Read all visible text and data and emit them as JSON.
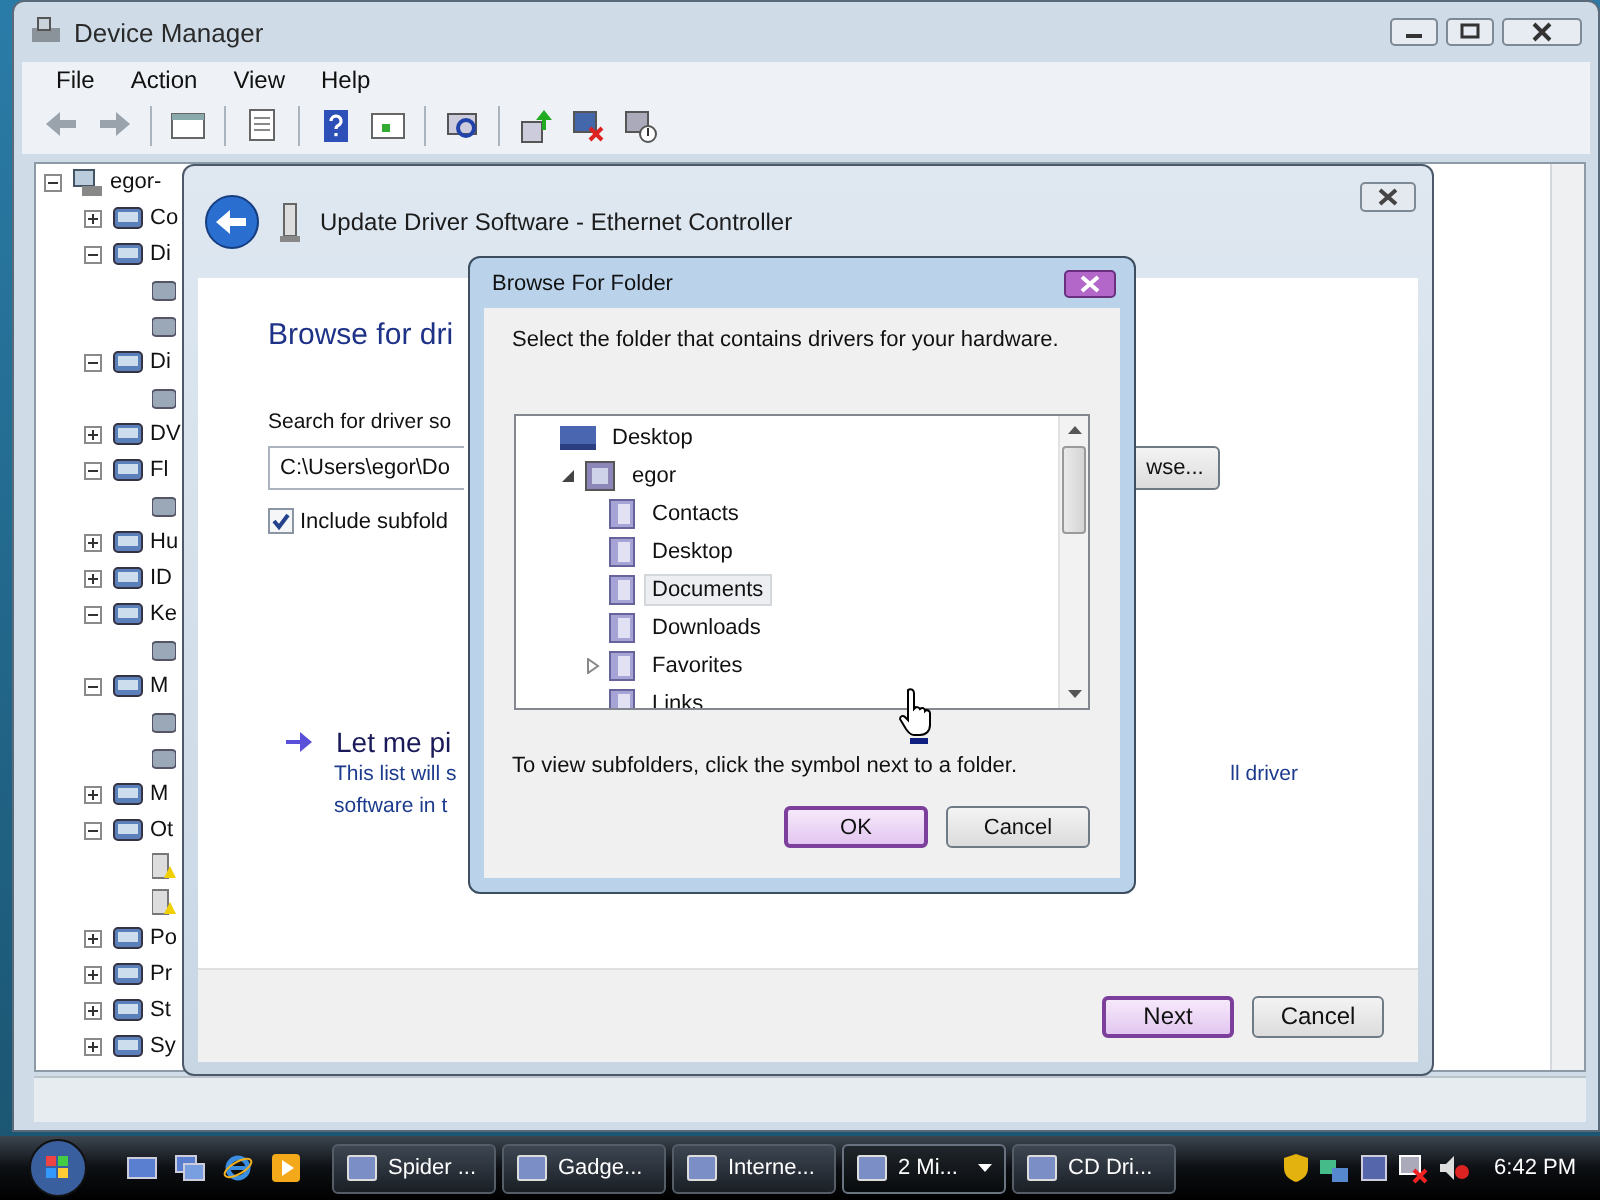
{
  "device_manager": {
    "title": "Device Manager",
    "menu": [
      "File",
      "Action",
      "View",
      "Help"
    ],
    "tree": [
      {
        "kind": "computer",
        "label": "egor-",
        "expanded": true,
        "children": [
          {
            "kind": "category",
            "label": "Co",
            "expanded": false
          },
          {
            "kind": "category",
            "label": "Di",
            "expanded": true,
            "children": [
              {
                "kind": "device"
              },
              {
                "kind": "device"
              }
            ]
          },
          {
            "kind": "category",
            "label": "Di",
            "expanded": true,
            "children": [
              {
                "kind": "device"
              }
            ]
          },
          {
            "kind": "category",
            "label": "DV",
            "expanded": false
          },
          {
            "kind": "category",
            "label": "Fl",
            "expanded": true,
            "children": [
              {
                "kind": "device"
              }
            ]
          },
          {
            "kind": "category",
            "label": "Hu",
            "expanded": false
          },
          {
            "kind": "category",
            "label": "ID",
            "expanded": false
          },
          {
            "kind": "category",
            "label": "Ke",
            "expanded": true,
            "children": [
              {
                "kind": "device"
              }
            ]
          },
          {
            "kind": "category",
            "label": "M",
            "expanded": true,
            "children": [
              {
                "kind": "device"
              },
              {
                "kind": "device"
              }
            ]
          },
          {
            "kind": "category",
            "label": "M",
            "expanded": false
          },
          {
            "kind": "category",
            "label": "Ot",
            "expanded": true,
            "children": [
              {
                "kind": "warning"
              },
              {
                "kind": "warning"
              }
            ]
          },
          {
            "kind": "category",
            "label": "Po",
            "expanded": false
          },
          {
            "kind": "category",
            "label": "Pr",
            "expanded": false
          },
          {
            "kind": "category",
            "label": "St",
            "expanded": false
          },
          {
            "kind": "category",
            "label": "Sy",
            "expanded": false
          }
        ]
      }
    ]
  },
  "wizard": {
    "title": "Update Driver Software - Ethernet Controller",
    "heading": "Browse for dri",
    "search_label": "Search for driver so",
    "path_value": "C:\\Users\\egor\\Do",
    "browse_button": "wse...",
    "include_subfolders": {
      "label": "Include subfold",
      "checked": true
    },
    "pick_link": "Let me pi",
    "pick_lines": [
      "This list will s",
      "software in t"
    ],
    "pick_right": "ll driver",
    "buttons": [
      {
        "label": "Next",
        "default": true
      },
      {
        "label": "Cancel",
        "default": false
      }
    ]
  },
  "browse_dialog": {
    "title": "Browse For Folder",
    "instruction": "Select the folder that contains drivers for your hardware.",
    "folders": [
      {
        "label": "Desktop",
        "kind": "desktop",
        "expandable": false,
        "selected": false,
        "children": [
          {
            "label": "egor",
            "kind": "user",
            "expandable": true,
            "expanded": true,
            "selected": false,
            "children": [
              {
                "label": "Contacts",
                "kind": "folder",
                "expandable": false,
                "selected": false
              },
              {
                "label": "Desktop",
                "kind": "folder",
                "expandable": false,
                "selected": false
              },
              {
                "label": "Documents",
                "kind": "folder",
                "expandable": false,
                "selected": true
              },
              {
                "label": "Downloads",
                "kind": "folder",
                "expandable": false,
                "selected": false
              },
              {
                "label": "Favorites",
                "kind": "folder",
                "expandable": true,
                "expanded": false,
                "selected": false
              },
              {
                "label": "Links",
                "kind": "folder",
                "expandable": false,
                "selected": false
              }
            ]
          }
        ]
      }
    ],
    "hint": "To view subfolders, click the symbol next to a folder.",
    "buttons": [
      {
        "label": "OK",
        "default": true
      },
      {
        "label": "Cancel",
        "default": false
      }
    ]
  },
  "taskbar": {
    "tasks": [
      {
        "label": "Spider ...",
        "selected": false,
        "grouped": false
      },
      {
        "label": "Gadge...",
        "selected": false,
        "grouped": false
      },
      {
        "label": "Interne...",
        "selected": false,
        "grouped": false
      },
      {
        "label": "2 Mi...",
        "selected": true,
        "grouped": true
      },
      {
        "label": "CD Dri...",
        "selected": false,
        "grouped": false
      }
    ],
    "clock": "6:42 PM"
  }
}
